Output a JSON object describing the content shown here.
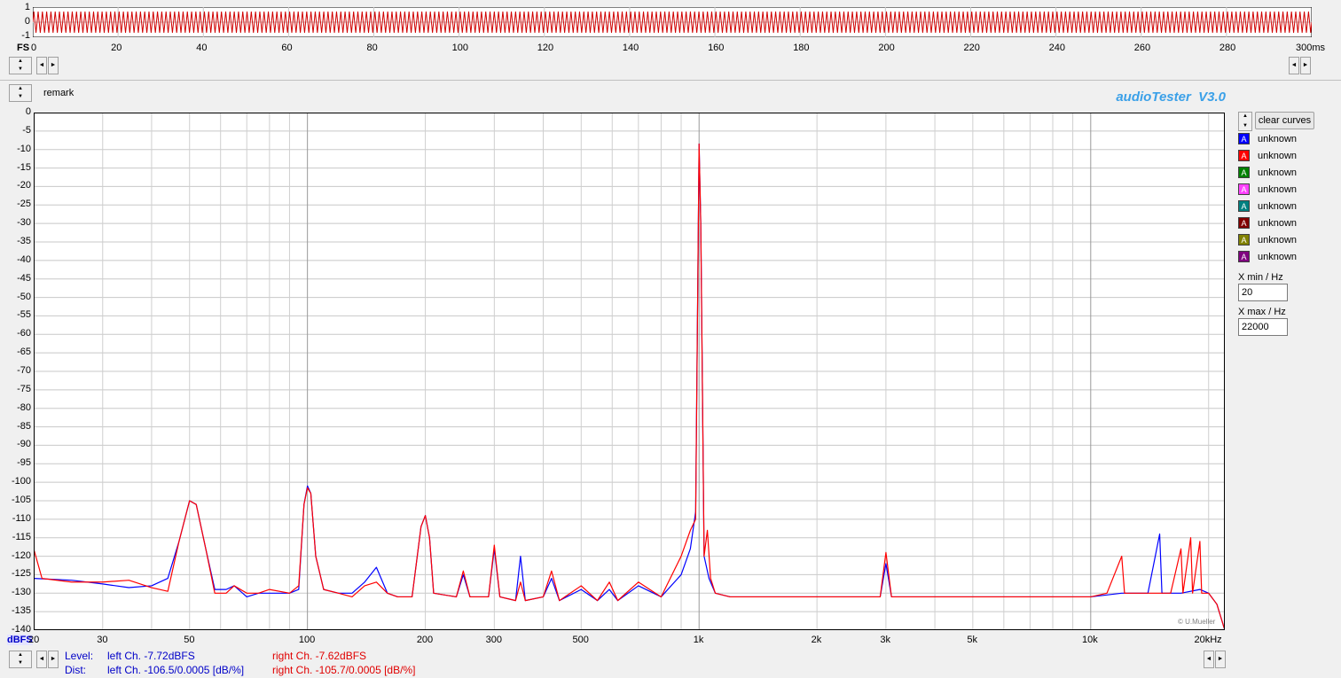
{
  "app": {
    "brand": "audioTester  V3.0",
    "remark": "remark",
    "copyright": "© U.Mueller"
  },
  "scope": {
    "y_ticks": [
      "1",
      "0",
      "-1"
    ],
    "unit_label": "FS",
    "x_ticks": [
      "0",
      "20",
      "40",
      "60",
      "80",
      "100",
      "120",
      "140",
      "160",
      "180",
      "200",
      "220",
      "240",
      "260",
      "280",
      "300ms"
    ]
  },
  "controls": {
    "spin_up": "▲",
    "spin_down": "▼",
    "arrow_left": "◄",
    "arrow_right": "►",
    "clear_curves": "clear curves",
    "xmin_label": "X min / Hz",
    "xmin_value": "20",
    "xmax_label": "X max / Hz",
    "xmax_value": "22000"
  },
  "legend": [
    {
      "letter": "A",
      "label": "unknown",
      "color": "#0000ff"
    },
    {
      "letter": "A",
      "label": "unknown",
      "color": "#ff0000"
    },
    {
      "letter": "A",
      "label": "unknown",
      "color": "#008000"
    },
    {
      "letter": "A",
      "label": "unknown",
      "color": "#ff40ff"
    },
    {
      "letter": "A",
      "label": "unknown",
      "color": "#008080"
    },
    {
      "letter": "A",
      "label": "unknown",
      "color": "#800000"
    },
    {
      "letter": "A",
      "label": "unknown",
      "color": "#808000"
    },
    {
      "letter": "A",
      "label": "unknown",
      "color": "#800080"
    }
  ],
  "stats": {
    "level_label": "Level:",
    "dist_label": "Dist:",
    "left_level": "left Ch. -7.72dBFS",
    "left_dist": "left Ch. -106.5/0.0005 [dB/%]",
    "right_level": "right Ch. -7.62dBFS",
    "right_dist": "right Ch. -105.7/0.0005 [dB/%]"
  },
  "chart_data": {
    "type": "line",
    "xscale": "log",
    "xlim": [
      20,
      22000
    ],
    "ylim": [
      -140,
      0
    ],
    "grid": true,
    "ylabel": "dBFS",
    "y_ticks": [
      "0",
      "-5",
      "-10",
      "-15",
      "-20",
      "-25",
      "-30",
      "-35",
      "-40",
      "-45",
      "-50",
      "-55",
      "-60",
      "-65",
      "-70",
      "-75",
      "-80",
      "-85",
      "-90",
      "-95",
      "-100",
      "-105",
      "-110",
      "-115",
      "-120",
      "-125",
      "-130",
      "-135",
      "-140"
    ],
    "x_ticks": [
      {
        "value": 20,
        "label": "20"
      },
      {
        "value": 30,
        "label": "30"
      },
      {
        "value": 50,
        "label": "50"
      },
      {
        "value": 100,
        "label": "100"
      },
      {
        "value": 200,
        "label": "200"
      },
      {
        "value": 300,
        "label": "300"
      },
      {
        "value": 500,
        "label": "500"
      },
      {
        "value": 1000,
        "label": "1k"
      },
      {
        "value": 2000,
        "label": "2k"
      },
      {
        "value": 3000,
        "label": "3k"
      },
      {
        "value": 5000,
        "label": "5k"
      },
      {
        "value": 10000,
        "label": "10k"
      },
      {
        "value": 20000,
        "label": "20kHz"
      }
    ],
    "series": [
      {
        "color": "#0000ff",
        "points": [
          [
            20,
            -126
          ],
          [
            25,
            -126.5
          ],
          [
            30,
            -127.5
          ],
          [
            35,
            -128.5
          ],
          [
            40,
            -128
          ],
          [
            44,
            -126
          ],
          [
            47,
            -116
          ],
          [
            50,
            -105
          ],
          [
            52,
            -106
          ],
          [
            55,
            -118
          ],
          [
            58,
            -129
          ],
          [
            62,
            -129
          ],
          [
            65,
            -128
          ],
          [
            70,
            -131
          ],
          [
            75,
            -130
          ],
          [
            80,
            -130
          ],
          [
            90,
            -130
          ],
          [
            95,
            -129
          ],
          [
            98,
            -106
          ],
          [
            100,
            -101
          ],
          [
            102,
            -103
          ],
          [
            105,
            -120
          ],
          [
            110,
            -129
          ],
          [
            120,
            -130
          ],
          [
            130,
            -130
          ],
          [
            140,
            -127
          ],
          [
            150,
            -123
          ],
          [
            160,
            -130
          ],
          [
            170,
            -131
          ],
          [
            185,
            -131
          ],
          [
            195,
            -112
          ],
          [
            200,
            -109
          ],
          [
            205,
            -115
          ],
          [
            210,
            -130
          ],
          [
            240,
            -131
          ],
          [
            250,
            -125
          ],
          [
            260,
            -131
          ],
          [
            290,
            -131
          ],
          [
            300,
            -118
          ],
          [
            310,
            -131
          ],
          [
            340,
            -132
          ],
          [
            350,
            -120
          ],
          [
            360,
            -132
          ],
          [
            400,
            -131
          ],
          [
            420,
            -126
          ],
          [
            440,
            -132
          ],
          [
            500,
            -129
          ],
          [
            550,
            -132
          ],
          [
            590,
            -129
          ],
          [
            620,
            -132
          ],
          [
            700,
            -128
          ],
          [
            800,
            -131
          ],
          [
            900,
            -125
          ],
          [
            950,
            -118
          ],
          [
            980,
            -108
          ],
          [
            1000,
            -8.5
          ],
          [
            1010,
            -30
          ],
          [
            1030,
            -120
          ],
          [
            1060,
            -126
          ],
          [
            1100,
            -130
          ],
          [
            1200,
            -131
          ],
          [
            1500,
            -131
          ],
          [
            2000,
            -131
          ],
          [
            2500,
            -131
          ],
          [
            2900,
            -131
          ],
          [
            3000,
            -122
          ],
          [
            3100,
            -131
          ],
          [
            4000,
            -131
          ],
          [
            5000,
            -131
          ],
          [
            6000,
            -131
          ],
          [
            7000,
            -131
          ],
          [
            8000,
            -131
          ],
          [
            10000,
            -131
          ],
          [
            12000,
            -130
          ],
          [
            14000,
            -130
          ],
          [
            15000,
            -114
          ],
          [
            15200,
            -130
          ],
          [
            17000,
            -130
          ],
          [
            19000,
            -129
          ],
          [
            20000,
            -130
          ],
          [
            21000,
            -133
          ],
          [
            22000,
            -140
          ]
        ]
      },
      {
        "color": "#ff0000",
        "points": [
          [
            20,
            -118
          ],
          [
            21,
            -126
          ],
          [
            25,
            -127
          ],
          [
            30,
            -127
          ],
          [
            35,
            -126.5
          ],
          [
            40,
            -128.5
          ],
          [
            44,
            -129.5
          ],
          [
            47,
            -116
          ],
          [
            50,
            -105
          ],
          [
            52,
            -106
          ],
          [
            55,
            -118
          ],
          [
            58,
            -130
          ],
          [
            62,
            -130
          ],
          [
            65,
            -128
          ],
          [
            70,
            -130
          ],
          [
            75,
            -130
          ],
          [
            80,
            -129
          ],
          [
            90,
            -130
          ],
          [
            95,
            -128
          ],
          [
            98,
            -106
          ],
          [
            100,
            -101.5
          ],
          [
            102,
            -103
          ],
          [
            105,
            -120
          ],
          [
            110,
            -129
          ],
          [
            120,
            -130
          ],
          [
            130,
            -131
          ],
          [
            140,
            -128
          ],
          [
            150,
            -127
          ],
          [
            160,
            -130
          ],
          [
            170,
            -131
          ],
          [
            185,
            -131
          ],
          [
            195,
            -112
          ],
          [
            200,
            -109
          ],
          [
            205,
            -115
          ],
          [
            210,
            -130
          ],
          [
            240,
            -131
          ],
          [
            250,
            -124
          ],
          [
            260,
            -131
          ],
          [
            290,
            -131
          ],
          [
            300,
            -117
          ],
          [
            310,
            -131
          ],
          [
            340,
            -132
          ],
          [
            350,
            -127
          ],
          [
            360,
            -132
          ],
          [
            400,
            -131
          ],
          [
            420,
            -124
          ],
          [
            440,
            -132
          ],
          [
            500,
            -128
          ],
          [
            550,
            -132
          ],
          [
            590,
            -127
          ],
          [
            620,
            -132
          ],
          [
            700,
            -127
          ],
          [
            800,
            -131
          ],
          [
            900,
            -120
          ],
          [
            950,
            -113
          ],
          [
            980,
            -110
          ],
          [
            1000,
            -8.5
          ],
          [
            1010,
            -30
          ],
          [
            1030,
            -120
          ],
          [
            1050,
            -113
          ],
          [
            1070,
            -126
          ],
          [
            1100,
            -130
          ],
          [
            1200,
            -131
          ],
          [
            1500,
            -131
          ],
          [
            2000,
            -131
          ],
          [
            2500,
            -131
          ],
          [
            2900,
            -131
          ],
          [
            3000,
            -119
          ],
          [
            3100,
            -131
          ],
          [
            4000,
            -131
          ],
          [
            5000,
            -131
          ],
          [
            6000,
            -131
          ],
          [
            7000,
            -131
          ],
          [
            8000,
            -131
          ],
          [
            10000,
            -131
          ],
          [
            11000,
            -130
          ],
          [
            12000,
            -120
          ],
          [
            12200,
            -130
          ],
          [
            14000,
            -130
          ],
          [
            16000,
            -130
          ],
          [
            17000,
            -118
          ],
          [
            17200,
            -130
          ],
          [
            18000,
            -115
          ],
          [
            18200,
            -130
          ],
          [
            19000,
            -116
          ],
          [
            19200,
            -130
          ],
          [
            20000,
            -130
          ],
          [
            21000,
            -133
          ],
          [
            22000,
            -140
          ]
        ]
      }
    ]
  }
}
